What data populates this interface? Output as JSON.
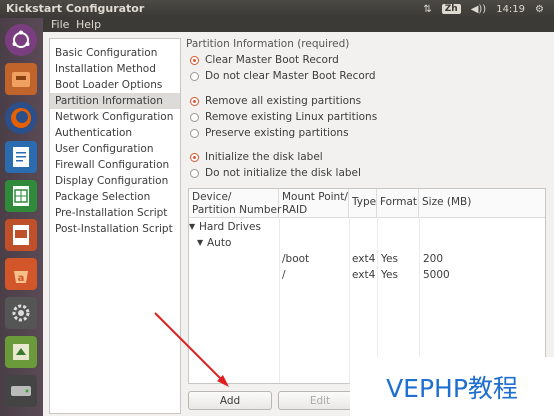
{
  "window": {
    "title": "Kickstart Configurator"
  },
  "tray": {
    "input_method": "Zh",
    "volume": "◀))",
    "time": "14:19",
    "network": "⇅"
  },
  "menu": {
    "file": "File",
    "help": "Help"
  },
  "sidebar": {
    "items": [
      {
        "label": "Basic Configuration"
      },
      {
        "label": "Installation Method"
      },
      {
        "label": "Boot Loader Options"
      },
      {
        "label": "Partition Information"
      },
      {
        "label": "Network Configuration"
      },
      {
        "label": "Authentication"
      },
      {
        "label": "User Configuration"
      },
      {
        "label": "Firewall Configuration"
      },
      {
        "label": "Display Configuration"
      },
      {
        "label": "Package Selection"
      },
      {
        "label": "Pre-Installation Script"
      },
      {
        "label": "Post-Installation Script"
      }
    ],
    "selected": "Partition Information"
  },
  "partition": {
    "section_title": "Partition Information (required)",
    "mbr": {
      "clear": "Clear Master Boot Record",
      "keep": "Do not clear Master Boot Record",
      "selected": "clear"
    },
    "partitions": {
      "remove_all": "Remove all existing partitions",
      "remove_linux": "Remove existing Linux partitions",
      "preserve": "Preserve existing partitions",
      "selected": "remove_all"
    },
    "disklabel": {
      "init": "Initialize the disk label",
      "no_init": "Do not initialize the disk label",
      "selected": "init"
    }
  },
  "table": {
    "headers": {
      "device": "Device/\nPartition Number",
      "mount": "Mount Point/\nRAID",
      "type": "Type",
      "format": "Format",
      "size": "Size (MB)"
    },
    "tree": {
      "hard_drives": "Hard Drives",
      "auto": "Auto",
      "expander": "▼"
    },
    "rows": [
      {
        "mount": "/boot",
        "type": "ext4",
        "format": "Yes",
        "size": "200"
      },
      {
        "mount": "/",
        "type": "ext4",
        "format": "Yes",
        "size": "5000"
      }
    ]
  },
  "buttons": {
    "add": "Add",
    "edit": "Edit"
  },
  "watermark": "VEPHP教程",
  "colors": {
    "accent": "#e05a2b",
    "watermark": "#1e6fd0",
    "launcher": "#4a3e47"
  }
}
